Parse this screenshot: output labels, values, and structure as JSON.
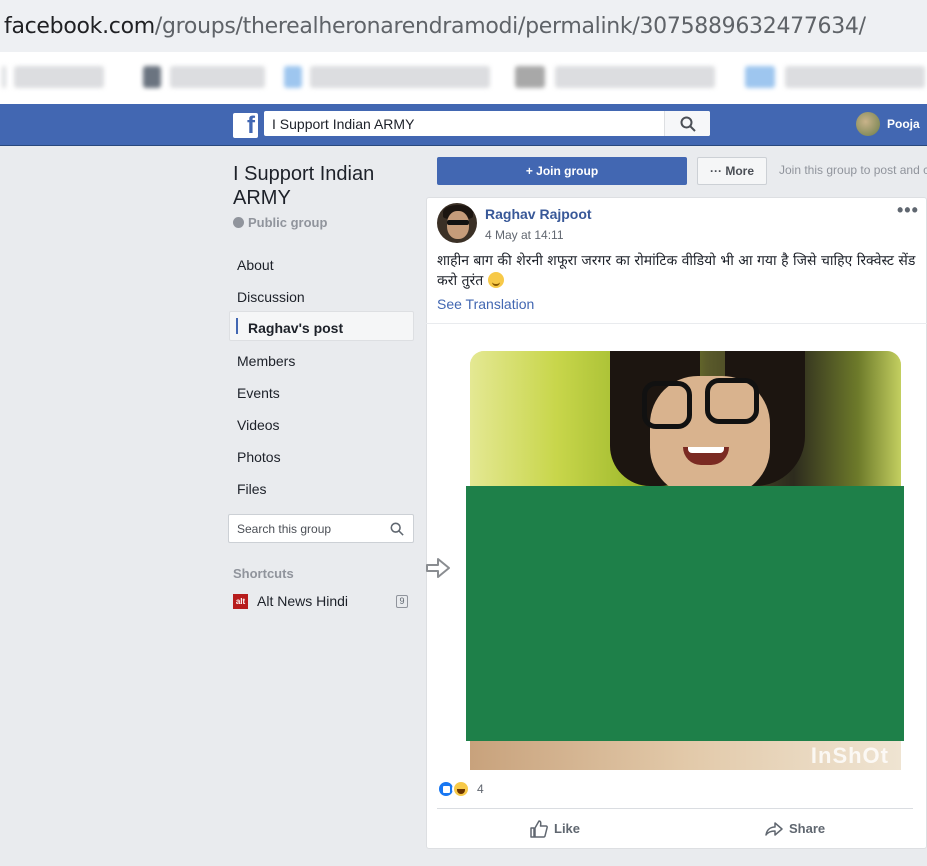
{
  "browser": {
    "url_host": "facebook.com",
    "url_path": "/groups/therealheronarendramodi/permalink/3075889632477634/"
  },
  "fb_header": {
    "logo": "f",
    "search_value": "I Support Indian ARMY",
    "search_icon": "search-icon",
    "profile_name": "Pooja"
  },
  "group": {
    "title": "I Support Indian ARMY",
    "privacy": "Public group",
    "nav": [
      "About",
      "Discussion",
      "Raghav's post",
      "Members",
      "Events",
      "Videos",
      "Photos",
      "Files"
    ],
    "active_nav": "Raghav's post",
    "search_placeholder": "Search this group",
    "shortcuts_heading": "Shortcuts",
    "shortcut_label": "Alt News Hindi",
    "shortcut_count": "9",
    "shortcut_icon_text": "alt"
  },
  "actions": {
    "join": "+ Join group",
    "more": "··· More",
    "join_hint": "Join this group to post and c"
  },
  "post": {
    "author": "Raghav Rajpoot",
    "time": "4 May at 14:11",
    "text": "शाहीन बाग की शेरनी शफूरा जरगर का रोमांटिक वीडियो भी आ गया है जिसे चाहिए रिक्वेस्ट सेंड करो तुरंत",
    "see_translation": "See Translation",
    "menu": "•••",
    "watermark": "InShOt",
    "reaction_count": "4",
    "like": "Like",
    "share": "Share",
    "censor_color": "#1e8049"
  },
  "colors": {
    "fb_blue": "#4267b2",
    "link": "#385898"
  }
}
